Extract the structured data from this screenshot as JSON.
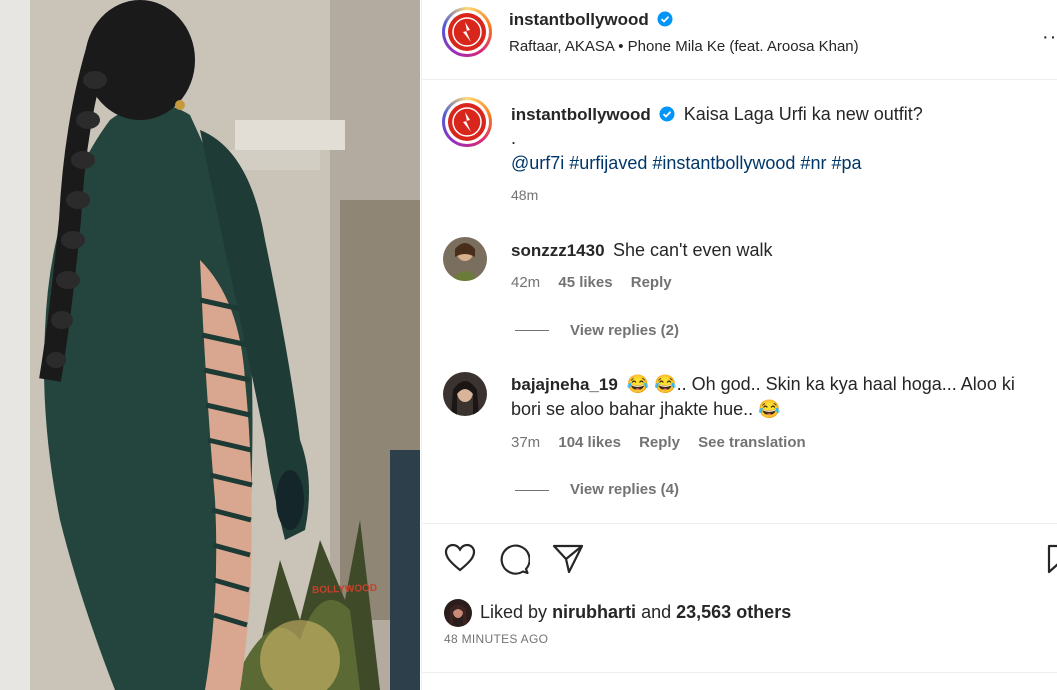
{
  "post": {
    "author": "instantbollywood",
    "audio": "Raftaar, AKASA • Phone Mila Ke (feat. Aroosa Khan)",
    "watermark": "BOLLYWOOD"
  },
  "caption": {
    "author": "instantbollywood",
    "text": "Kaisa Laga Urfi ka new outfit?",
    "dot": ".",
    "hashtags": "@urf7i #urfijaved #instantbollywood #nr #pa",
    "time": "48m"
  },
  "comments": [
    {
      "user": "sonzzz1430",
      "text": "She can't even walk",
      "time": "42m",
      "likes": "45 likes",
      "reply": "Reply",
      "view_replies": "View replies (2)"
    },
    {
      "user": "bajajneha_19",
      "text_line1": "😂 😂.. Oh god.. Skin ka kya haal hoga... Aloo ki",
      "text_line2": "bori se aloo bahar jhakte hue.. 😂",
      "time": "37m",
      "likes": "104 likes",
      "reply": "Reply",
      "translate": "See translation",
      "view_replies": "View replies (4)"
    }
  ],
  "likes": {
    "prefix": "Liked by",
    "user": "nirubharti",
    "middle": "and",
    "count": "23,563 others"
  },
  "posted": "48 MINUTES AGO",
  "icons": {
    "like": "heart-icon",
    "comment": "comment-icon",
    "share": "send-icon",
    "save": "bookmark-icon",
    "more": "more-icon",
    "verified": "verified-badge-icon"
  },
  "colors": {
    "link": "#00376b",
    "muted": "#737373",
    "verified": "#0095f6"
  }
}
